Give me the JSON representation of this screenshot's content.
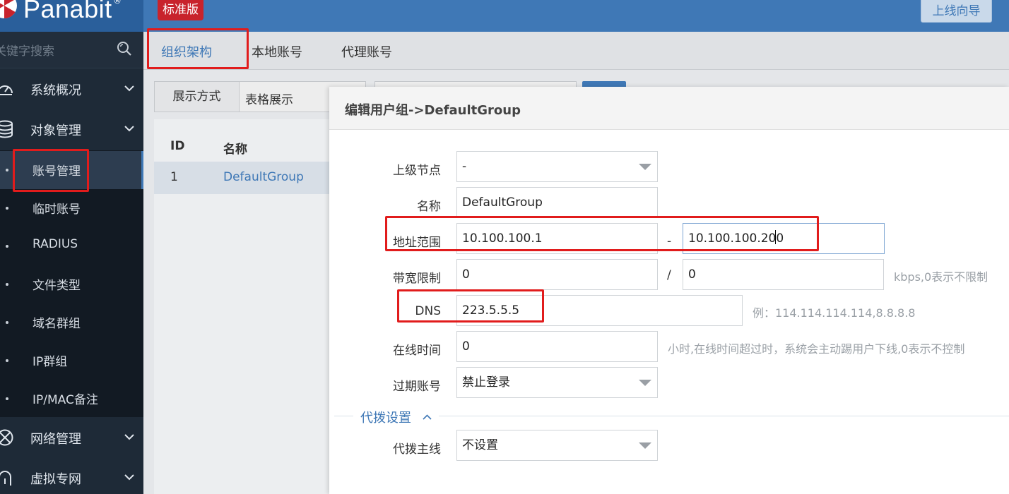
{
  "header": {
    "logo_text": "Panabit",
    "logo_reg": "®",
    "edition": "标准版",
    "wizard_button": "上线向导"
  },
  "sidebar": {
    "search_placeholder": "关键字搜索",
    "groups": [
      {
        "label": "系统概况",
        "icon": "gauge-icon"
      },
      {
        "label": "对象管理",
        "icon": "database-icon"
      },
      {
        "label": "网络管理",
        "icon": "network-icon"
      },
      {
        "label": "虚拟专网",
        "icon": "vpn-icon"
      }
    ],
    "items": [
      {
        "label": "账号管理",
        "active": true
      },
      {
        "label": "临时账号"
      },
      {
        "label": "RADIUS"
      },
      {
        "label": "文件类型"
      },
      {
        "label": "域名群组"
      },
      {
        "label": "IP群组"
      },
      {
        "label": "IP/MAC备注"
      }
    ]
  },
  "tabs": [
    {
      "label": "组织架构",
      "active": true
    },
    {
      "label": "本地账号"
    },
    {
      "label": "代理账号"
    }
  ],
  "toolbar": {
    "display_label": "展示方式",
    "display_value": "表格展示"
  },
  "table": {
    "columns": [
      "ID",
      "名称"
    ],
    "rows": [
      {
        "id": "1",
        "name": "DefaultGroup"
      }
    ]
  },
  "modal": {
    "title": "编辑用户组->DefaultGroup",
    "parent_label": "上级节点",
    "parent_value": "-",
    "name_label": "名称",
    "name_value": "DefaultGroup",
    "addr_label": "地址范围",
    "addr_start": "10.100.100.1",
    "addr_sep": "-",
    "addr_end_before": "10.100.100.20",
    "addr_end_after": "0",
    "bw_label": "带宽限制",
    "bw_up": "0",
    "bw_sep": "/",
    "bw_down": "0",
    "bw_hint": "kbps,0表示不限制",
    "dns_label": "DNS",
    "dns_value": "223.5.5.5",
    "dns_hint": "例：114.114.114.114,8.8.8.8",
    "online_label": "在线时间",
    "online_value": "0",
    "online_hint": "小时,在线时间超过时，系统会主动踢用户下线,0表示不控制",
    "expired_label": "过期账号",
    "expired_value": "禁止登录",
    "section_title": "代拨设置",
    "dial_label": "代拨主线",
    "dial_value": "不设置"
  },
  "colors": {
    "brand_blue": "#3f78b6",
    "highlight_red": "#e11c1c",
    "edition_red": "#c8232c"
  }
}
